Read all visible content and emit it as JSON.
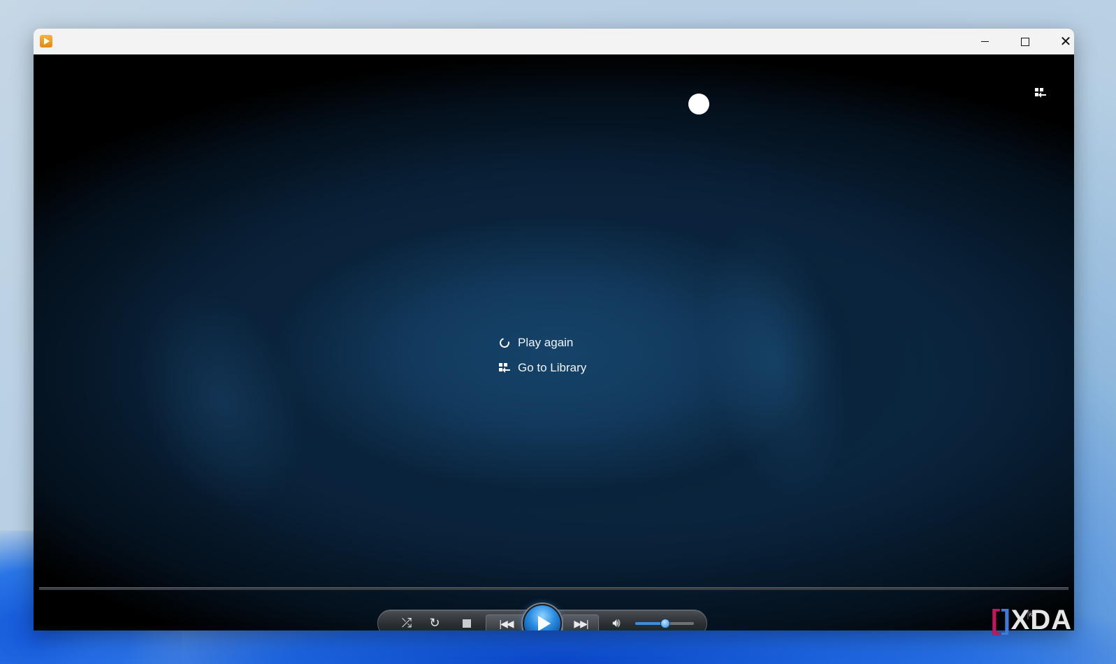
{
  "window": {
    "app_icon": "media-player-icon",
    "controls": {
      "minimize": "minimize-icon",
      "maximize": "maximize-icon",
      "close": "close-icon"
    }
  },
  "overlay": {
    "switch_to_library_icon": "library-switch-icon",
    "menu": [
      {
        "label": "Play again",
        "icon": "replay-icon"
      },
      {
        "label": "Go to Library",
        "icon": "library-icon"
      }
    ]
  },
  "transport": {
    "buttons": [
      "shuffle-icon",
      "repeat-icon",
      "stop-icon",
      "previous-icon",
      "play-icon",
      "next-icon",
      "volume-icon"
    ],
    "volume_level": 0.5,
    "seek_position": 0,
    "accent_color": "#2a8ce0"
  },
  "watermark": {
    "text": "XDA"
  }
}
